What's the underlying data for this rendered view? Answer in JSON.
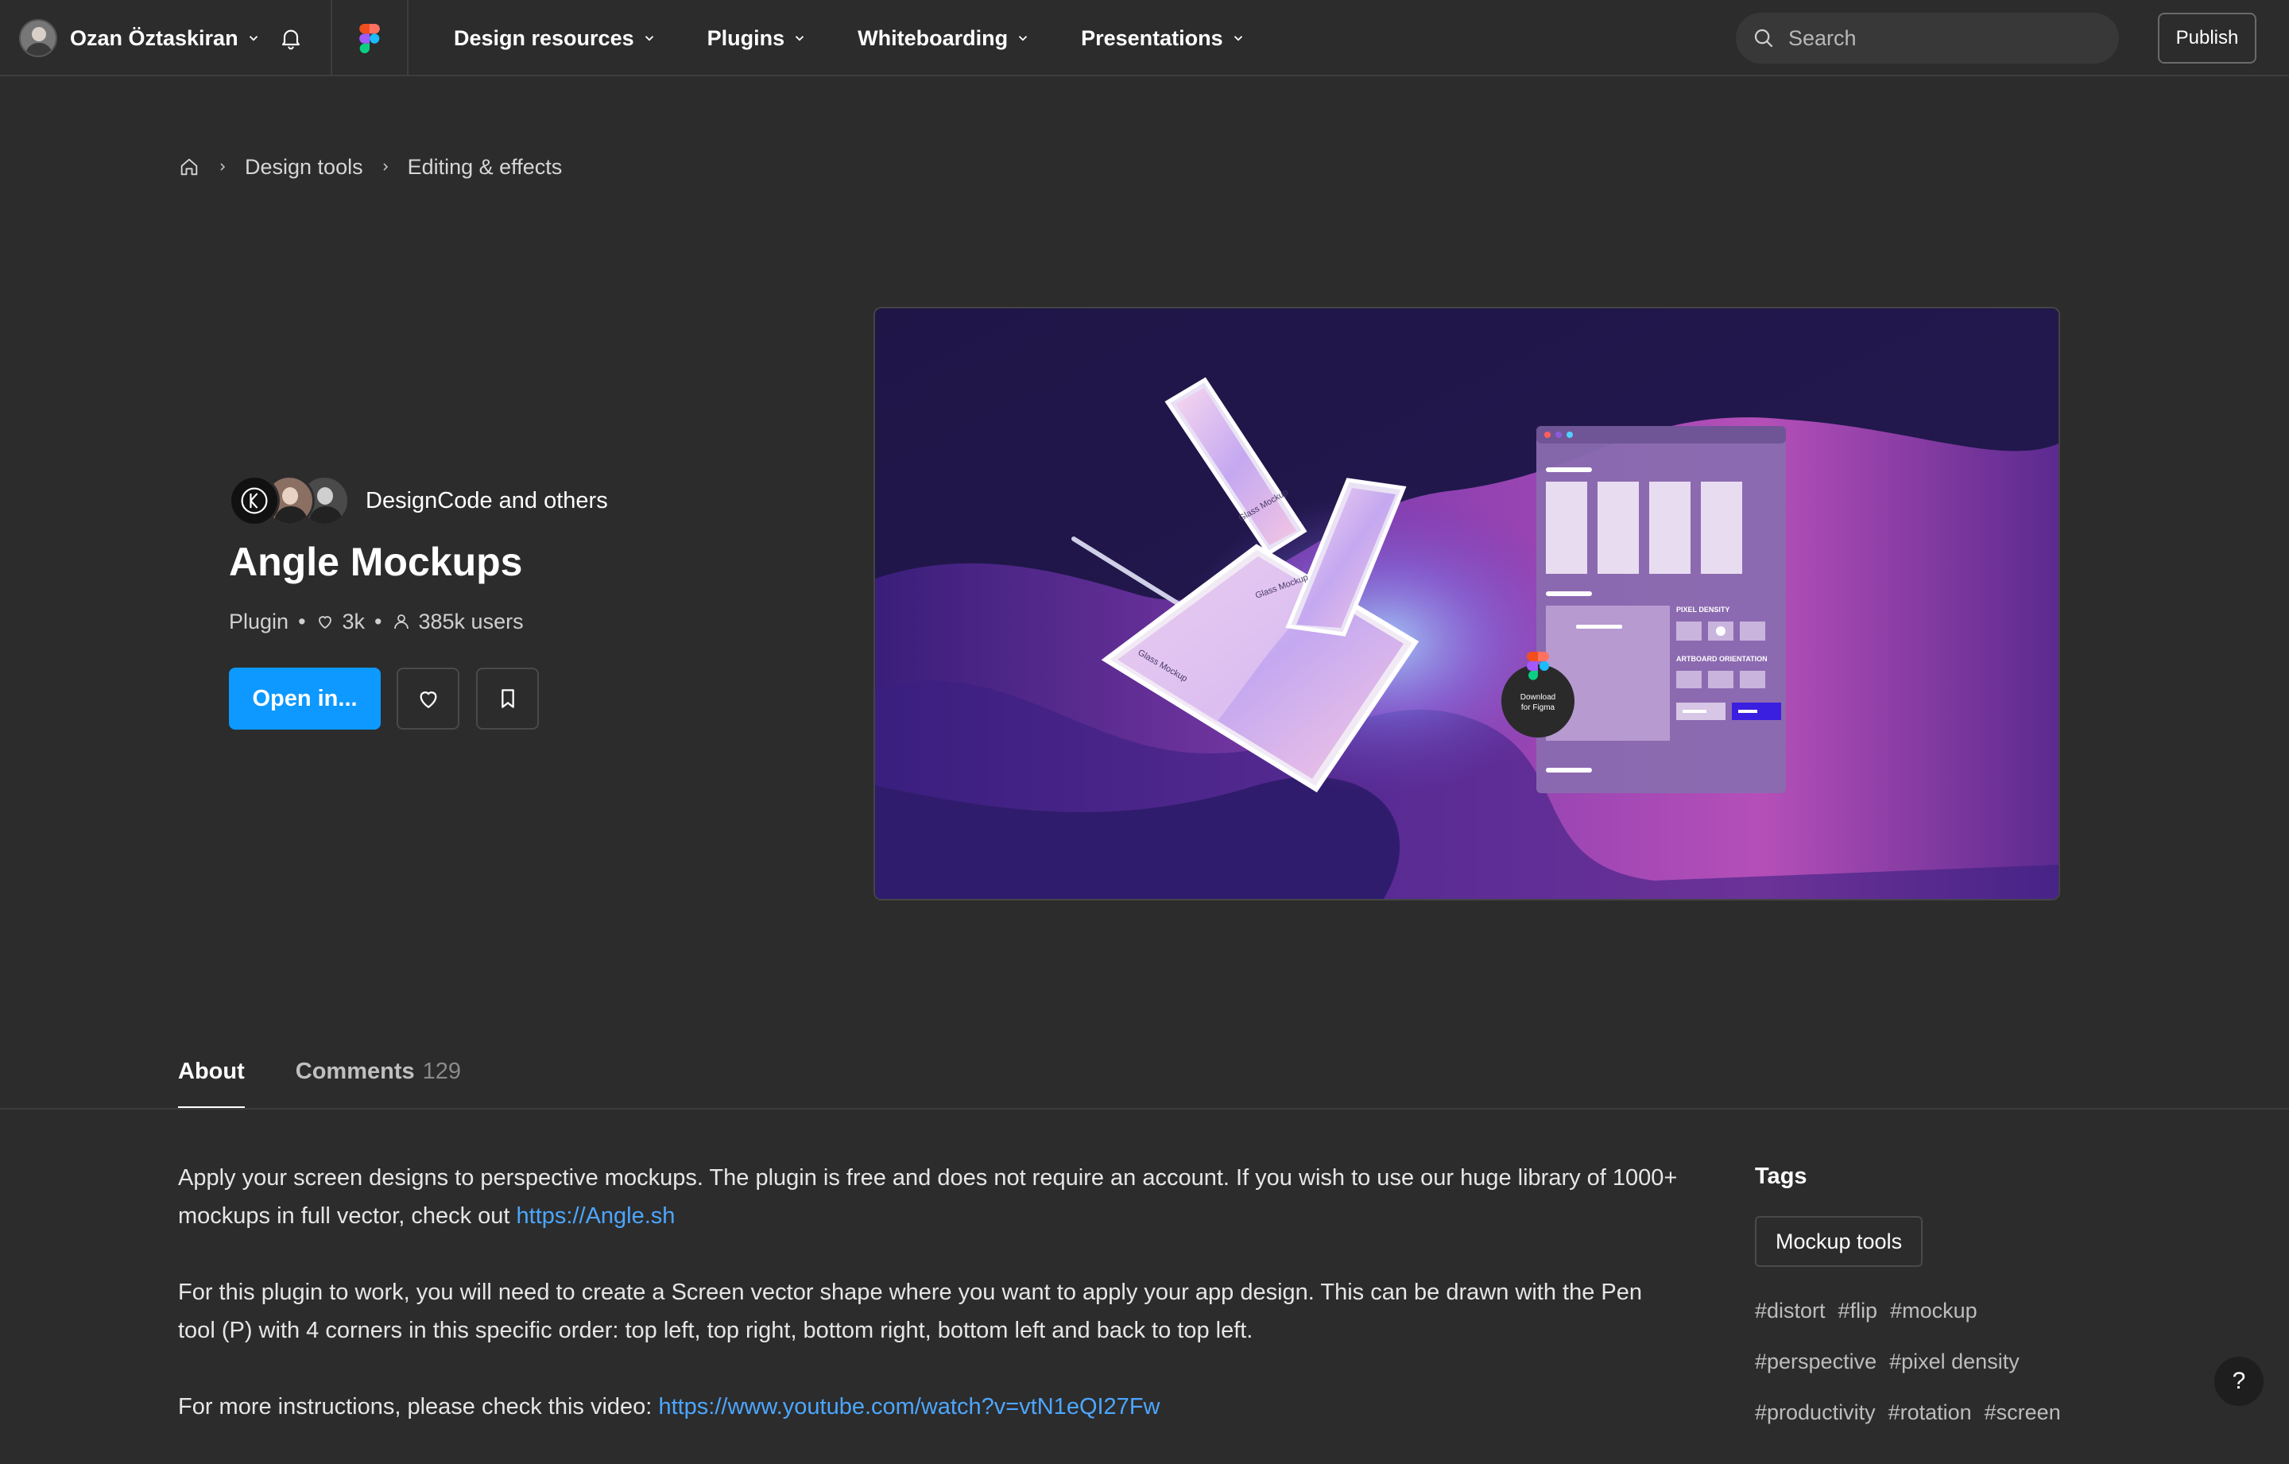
{
  "topnav": {
    "user_name": "Ozan Öztaskiran",
    "links": [
      "Design resources",
      "Plugins",
      "Whiteboarding",
      "Presentations"
    ],
    "search_placeholder": "Search",
    "publish_label": "Publish"
  },
  "breadcrumb": {
    "items": [
      "Design tools",
      "Editing & effects"
    ]
  },
  "plugin": {
    "authors": "DesignCode and others",
    "title": "Angle Mockups",
    "type": "Plugin",
    "likes": "3k",
    "users": "385k users",
    "open_label": "Open in..."
  },
  "mockup_art": {
    "glass_label": "Glass Mockup",
    "pixel_density": "PIXEL DENSITY",
    "artboard_orientation": "ARTBOARD ORIENTATION",
    "download_line1": "Download",
    "download_line2": "for Figma"
  },
  "tabs": {
    "about": "About",
    "comments": "Comments",
    "comments_count": "129"
  },
  "description": {
    "p1_text": "Apply your screen designs to perspective mockups. The plugin is free and does not require an account. If you wish to use our huge library of 1000+ mockups in full vector, check out ",
    "p1_link": "https://Angle.sh",
    "p2_text": "For this plugin to work, you will need to create a Screen vector shape where you want to apply your app design. This can be drawn with the Pen tool (P) with 4 corners in this specific order: top left, top right, bottom right, bottom left and back to top left.",
    "p3_text": "For more instructions, please check this video: ",
    "p3_link": "https://www.youtube.com/watch?v=vtN1eQI27Fw"
  },
  "tags": {
    "title": "Tags",
    "chip": "Mockup tools",
    "rows": [
      [
        "#distort",
        "#flip",
        "#mockup"
      ],
      [
        "#perspective",
        "#pixel density"
      ],
      [
        "#productivity",
        "#rotation",
        "#screen"
      ]
    ]
  },
  "help_label": "?",
  "colors": {
    "background": "#2c2c2c",
    "accent": "#0d99ff",
    "link": "#4da6ff"
  }
}
